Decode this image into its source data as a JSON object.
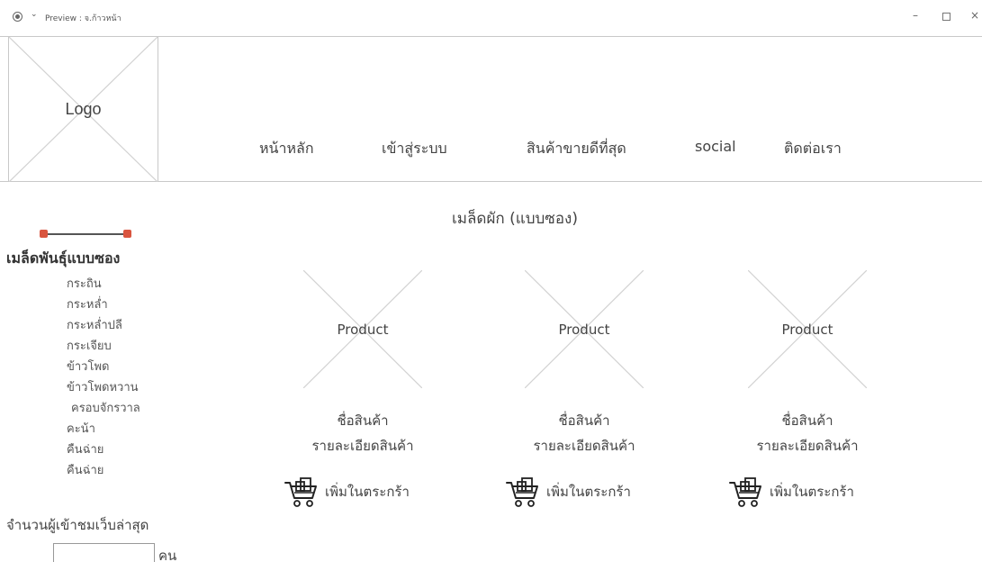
{
  "window": {
    "title": "Preview : จ.ก้าวหน้า",
    "controls": [
      "–",
      "□",
      "×"
    ]
  },
  "header": {
    "logo_text": "Logo",
    "nav": [
      "หน้าหลัก",
      "เข้าสู่ระบบ",
      "สินค้าขายดีที่สุด",
      "social",
      "ติดต่อเรา"
    ]
  },
  "sidebar": {
    "slider": {
      "accent_color": "#d9553f"
    },
    "category_title": "เมล็ดพันธุ์แบบซอง",
    "items": [
      "กระถิน",
      "กระหล่ำ",
      "กระหล่ำปลี",
      "กระเจียบ",
      "ข้าวโพด",
      "ข้าวโพดหวาน",
      "ครอบจักรวาล",
      "คะน้า",
      "คืนฉ่าย",
      "คืนฉ่าย"
    ],
    "visitors": {
      "label": "จำนวนผู้เข้าชมเว็บล่าสุด",
      "value": "",
      "unit": "คน"
    }
  },
  "main": {
    "section_title": "เมล็ดผัก (แบบซอง)",
    "products": [
      {
        "image_text": "Product",
        "name": "ชื่อสินค้า",
        "description": "รายละเอียดสินค้า",
        "cart_label": "เพิ่มในตระกร้า",
        "cart_icon": "shopping-cart-icon"
      },
      {
        "image_text": "Product",
        "name": "ชื่อสินค้า",
        "description": "รายละเอียดสินค้า",
        "cart_label": "เพิ่มในตระกร้า",
        "cart_icon": "shopping-cart-icon"
      },
      {
        "image_text": "Product",
        "name": "ชื่อสินค้า",
        "description": "รายละเอียดสินค้า",
        "cart_label": "เพิ่มในตระกร้า",
        "cart_icon": "shopping-cart-icon"
      }
    ]
  }
}
